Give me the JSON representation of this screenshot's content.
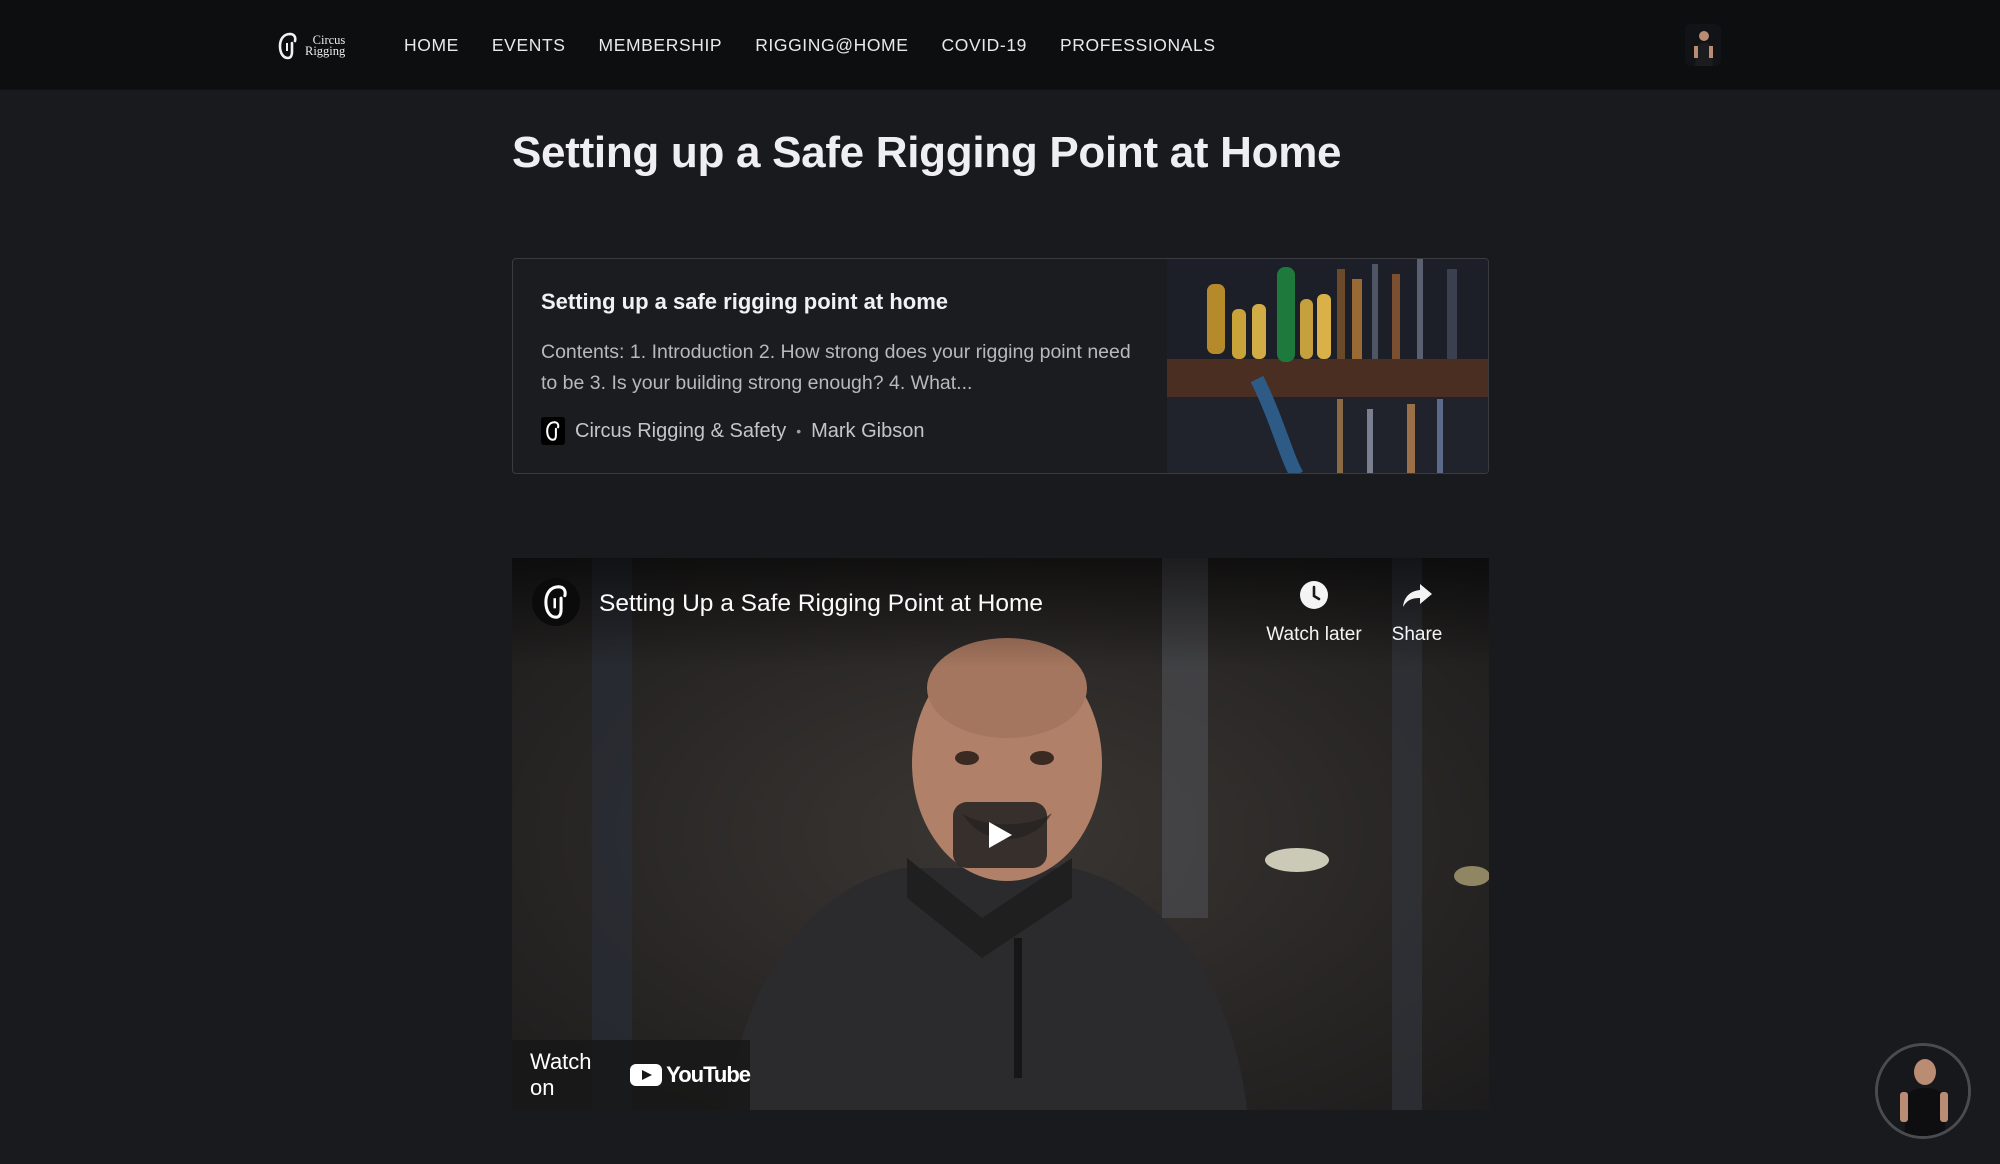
{
  "nav": {
    "logo_line1": "Circus",
    "logo_line2": "Rigging",
    "items": [
      {
        "label": "HOME"
      },
      {
        "label": "EVENTS"
      },
      {
        "label": "MEMBERSHIP"
      },
      {
        "label": "RIGGING@HOME"
      },
      {
        "label": "COVID-19"
      },
      {
        "label": "PROFESSIONALS"
      }
    ]
  },
  "page": {
    "title": "Setting up a Safe Rigging Point at Home"
  },
  "card": {
    "title": "Setting up a safe rigging point at home",
    "description": "Contents: 1. Introduction 2. How strong does your rigging point need to be 3. Is your building strong enough? 4. What...",
    "site": "Circus Rigging & Safety",
    "separator": "•",
    "author": "Mark Gibson"
  },
  "video": {
    "title": "Setting Up a Safe Rigging Point at Home",
    "watch_later": "Watch later",
    "share": "Share",
    "watch_on": "Watch on",
    "youtube": "YouTube"
  },
  "colors": {
    "background": "#191a1e",
    "topbar": "#0d0e10",
    "youtube_red": "#ff0000"
  },
  "icons": {
    "logo": "carabiner-icon",
    "watch_later": "clock-icon",
    "share": "share-arrow-icon",
    "play": "play-icon"
  }
}
